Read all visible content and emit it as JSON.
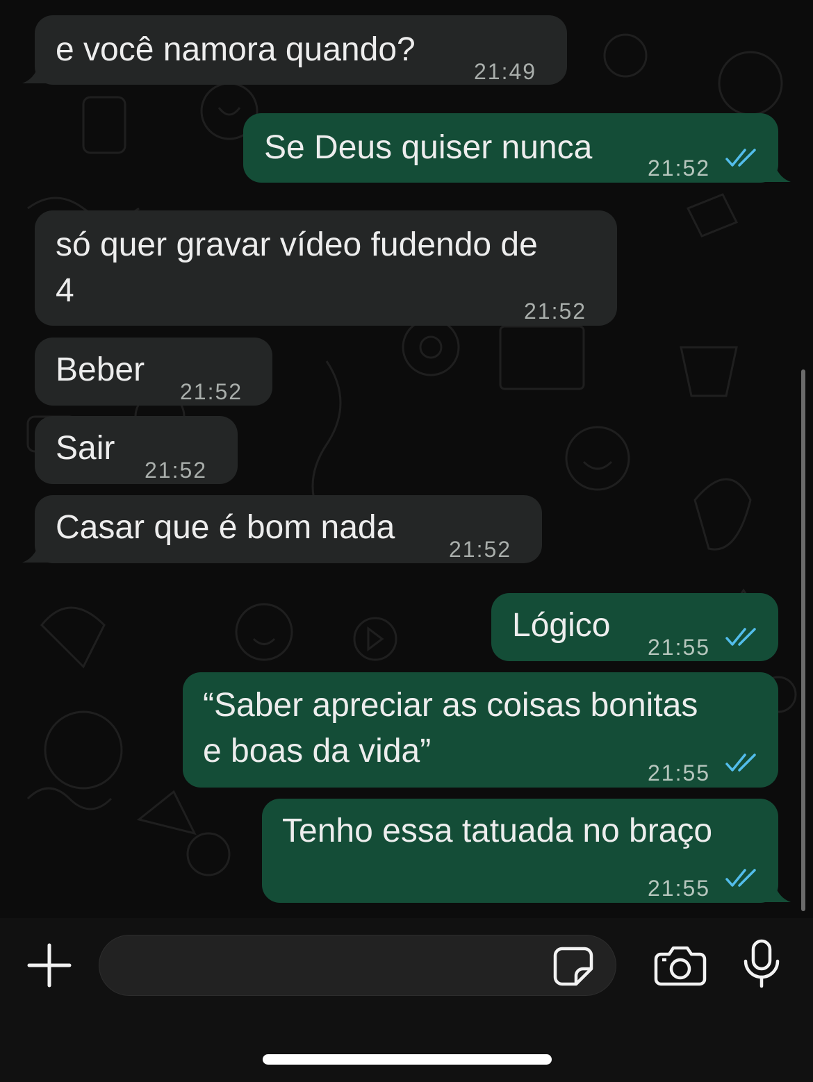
{
  "messages": [
    {
      "direction": "in",
      "text": "e você namora quando?",
      "time": "21:49"
    },
    {
      "direction": "out",
      "text": "Se Deus quiser nunca",
      "time": "21:52",
      "status": "read"
    },
    {
      "direction": "in",
      "lines": [
        "só quer gravar vídeo fudendo de",
        "4"
      ],
      "time": "21:52"
    },
    {
      "direction": "in",
      "text": "Beber",
      "time": "21:52"
    },
    {
      "direction": "in",
      "text": "Sair",
      "time": "21:52"
    },
    {
      "direction": "in",
      "text": "Casar que é bom nada",
      "time": "21:52"
    },
    {
      "direction": "out",
      "text": "Lógico",
      "time": "21:55",
      "status": "read"
    },
    {
      "direction": "out",
      "lines": [
        "“Saber apreciar as coisas bonitas",
        "e boas da vida”"
      ],
      "time": "21:55",
      "status": "read"
    },
    {
      "direction": "out",
      "text": "Tenho essa tatuada no braço",
      "time": "21:55",
      "status": "read"
    }
  ],
  "composer": {
    "placeholder": "",
    "icons": [
      "plus-icon",
      "sticker-icon",
      "camera-icon",
      "microphone-icon"
    ]
  },
  "colors": {
    "incoming_bubble": "#242626",
    "outgoing_bubble": "#144d37",
    "read_ticks": "#53bdeb",
    "background": "#0c0c0c"
  }
}
